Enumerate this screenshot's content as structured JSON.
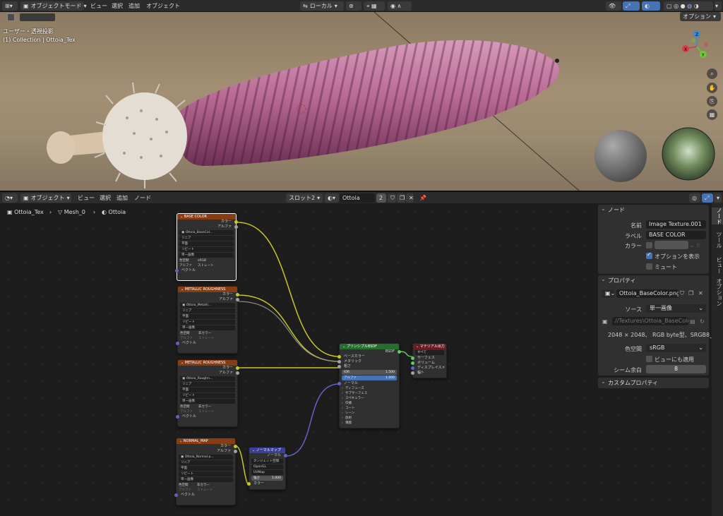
{
  "topbar": {
    "mode": "オブジェクトモード",
    "menus": [
      "ビュー",
      "選択",
      "追加",
      "オブジェクト"
    ],
    "transform_orientation": "ローカル",
    "options": "オプション"
  },
  "viewport": {
    "view_name": "ユーザー・透視投影",
    "collection": "(1) Collection | Ottoia_Tex",
    "gizmo_axes": [
      "X",
      "Y",
      "Z"
    ]
  },
  "node_editor": {
    "editor_type": "オブジェクト",
    "menus": [
      "ビュー",
      "選択",
      "追加",
      "ノード"
    ],
    "slot": "スロット2",
    "material_name": "Ottoia",
    "user_count": "2",
    "breadcrumb": [
      "Ottoia_Tex",
      "Mesh_0",
      "Ottoia"
    ]
  },
  "nodes": {
    "tex1": {
      "title": "BASE COLOR",
      "out_color": "カラー",
      "out_alpha": "アルファ",
      "image": "Ottoia_BaseCol...",
      "interp": "リニア",
      "proj": "平面",
      "ext": "リピート",
      "src": "単一画像",
      "cs_label": "色空間",
      "cs": "sRGB",
      "alpha_label": "アルファ",
      "alpha": "ストレート",
      "vec": "ベクトル"
    },
    "tex2": {
      "title": "METALLIC ROUGHNESS",
      "out_color": "カラー",
      "out_alpha": "アルファ",
      "image": "Ottoia_Metalli...",
      "interp": "リニア",
      "proj": "平面",
      "ext": "リピート",
      "src": "単一画像",
      "cs_label": "色空間",
      "cs": "非カラー",
      "alpha_label": "アルファ",
      "alpha": "ストレート",
      "vec": "ベクトル"
    },
    "tex3": {
      "title": "METALLIC ROUGHNESS",
      "out_color": "カラー",
      "out_alpha": "アルファ",
      "image": "Ottoia_Roughn...",
      "interp": "リニア",
      "proj": "平面",
      "ext": "リピート",
      "src": "単一画像",
      "cs_label": "色空間",
      "cs": "非カラー",
      "alpha_label": "アルファ",
      "alpha": "ストレート",
      "vec": "ベクトル"
    },
    "tex4": {
      "title": "NORMAL_MAP",
      "out_color": "カラー",
      "out_alpha": "アルファ",
      "image": "Ottoia_Normal.p...",
      "interp": "リニア",
      "proj": "平面",
      "ext": "リピート",
      "src": "単一画像",
      "cs_label": "色空間",
      "cs": "非カラー",
      "alpha_label": "アルファ",
      "alpha": "ストレート",
      "vec": "ベクトル"
    },
    "bsdf": {
      "title": "プリンシプルBSDF",
      "out": "BSDF",
      "inputs": [
        "ベースカラー",
        "メタリック",
        "粗さ"
      ],
      "ior_label": "IOR",
      "ior": "1.500",
      "alpha_label": "アルファ",
      "alpha": "1.000",
      "normal": "ノーマル",
      "subpanels": [
        "ディフューズ",
        "サブサーフェス",
        "スペキュラー",
        "伝播",
        "コート",
        "シーン",
        "放射",
        "薄膜"
      ]
    },
    "out": {
      "title": "マテリアル出力",
      "target": "すべて",
      "inputs": [
        "サーフェス",
        "ボリューム",
        "ディスプレイスメント",
        "幅"
      ]
    },
    "nmap": {
      "title": "ノーマルマップ",
      "out": "ノーマル",
      "space": "タンジェント空間",
      "convention": "OpenGL",
      "uv": "UVMap",
      "strength_label": "強さ",
      "strength": "1.000",
      "color": "カラー"
    }
  },
  "npanel": {
    "tabs": [
      "ノード",
      "ツール",
      "ビュー",
      "オプション"
    ],
    "node_section": "ノード",
    "name_label": "名前",
    "name": "Image Texture.001",
    "label_label": "ラベル",
    "label": "BASE COLOR",
    "color_label": "カラー",
    "show_options": "オプションを表示",
    "mute": "ミュート",
    "props_section": "プロパティ",
    "image_name": "Ottoia_BaseColor.png",
    "source_label": "ソース",
    "source": "単一画像",
    "filepath": "//Textures\\Ottoia_BaseColo...",
    "image_info": "2048 × 2048、 RGB byte型、SRGB8_A8",
    "colorspace_label": "色空間",
    "colorspace": "sRGB",
    "view_as_render": "ビューにも適用",
    "seam_label": "シーム余白",
    "seam": "8",
    "custom_props": "カスタムプロパティ"
  },
  "colors": {
    "accent": "#4772b3",
    "tex_header": "#883c13",
    "bsdf_header": "#276e2e",
    "output_header": "#6b1d22",
    "vector_header": "#3b3e9b",
    "worm": "#b96a95"
  }
}
